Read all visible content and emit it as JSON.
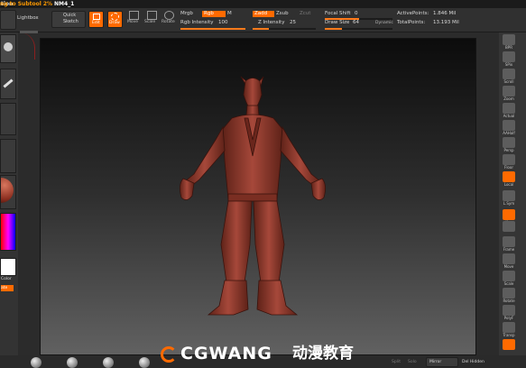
{
  "title_bar": {
    "left_text": "tion",
    "subtool_label": "ng to Subtool 2%",
    "subtool_name": "NM4_1"
  },
  "top_left": {
    "lightbox_label": "Lightbox",
    "quick_sketch_line1": "Quick",
    "quick_sketch_line2": "Sketch"
  },
  "toolbar": {
    "edit_label": "Edit",
    "draw_label": "Draw",
    "move_label": "Move",
    "scale_label": "Scale",
    "rotate_label": "Rotate",
    "mrgb_label": "Mrgb",
    "rgb_label": "Rgb",
    "m_label": "M",
    "rgb_intensity_label": "Rgb Intensity",
    "rgb_intensity_value": "100",
    "zadd_label": "Zadd",
    "zsub_label": "Zsub",
    "zcut_label": "Zcut",
    "z_intensity_label": "Z Intensity",
    "z_intensity_value": "25",
    "focal_shift_label": "Focal Shift",
    "focal_shift_value": "0",
    "draw_size_label": "Draw Size",
    "draw_size_value": "64",
    "dynamic_label": "Dynamic",
    "active_points_label": "ActivePoints:",
    "active_points_value": "1.846 Mil",
    "total_points_label": "TotalPoints:",
    "total_points_value": "13.193 Mil"
  },
  "left_panel": {
    "labels": [
      "",
      "",
      "",
      "",
      "",
      "",
      "",
      "",
      "Color",
      "ate"
    ]
  },
  "right_panel": {
    "buttons": [
      {
        "label": "BPR",
        "icon": "bpr-icon",
        "active": false
      },
      {
        "label": "SPix",
        "icon": "spix-icon",
        "active": false
      },
      {
        "label": "Scroll",
        "icon": "scroll-icon",
        "active": false
      },
      {
        "label": "Zoom",
        "icon": "zoom-icon",
        "active": false
      },
      {
        "label": "Actual",
        "icon": "actual-icon",
        "active": false
      },
      {
        "label": "AAHalf",
        "icon": "aahalf-icon",
        "active": false
      },
      {
        "label": "Persp",
        "icon": "persp-icon",
        "active": false
      },
      {
        "label": "Floor",
        "icon": "floor-icon",
        "active": false
      },
      {
        "label": "Local",
        "icon": "local-icon",
        "active": true
      },
      {
        "label": "L.Sym",
        "icon": "lsym-icon",
        "active": false
      },
      {
        "label": "Xyz",
        "icon": "xyz-icon",
        "active": true
      },
      {
        "label": "",
        "icon": "rotate-axis-icon",
        "active": false
      },
      {
        "label": "Frame",
        "icon": "frame-icon",
        "active": false
      },
      {
        "label": "Move",
        "icon": "move-icon",
        "active": false
      },
      {
        "label": "Scale",
        "icon": "scale-icon",
        "active": false
      },
      {
        "label": "Rotate",
        "icon": "rotate-icon",
        "active": false
      },
      {
        "label": "PolyF",
        "icon": "polyf-icon",
        "active": false
      },
      {
        "label": "Transp",
        "icon": "transp-icon",
        "active": false
      },
      {
        "label": "",
        "icon": "solo-icon",
        "active": true
      }
    ]
  },
  "bottom_bar": {
    "text_split": "Split",
    "text_solo": "Solo",
    "text_mirror": "Mirror",
    "text_del_hidden": "Del Hidden"
  },
  "watermark": {
    "brand_text": "CGWANG",
    "brand_cn": "动漫教育"
  },
  "colors": {
    "accent": "#ff6a00",
    "model": "#8f3a2d",
    "panel": "#303030",
    "canvas_top": "#0c0c0c",
    "canvas_bottom": "#616161"
  }
}
